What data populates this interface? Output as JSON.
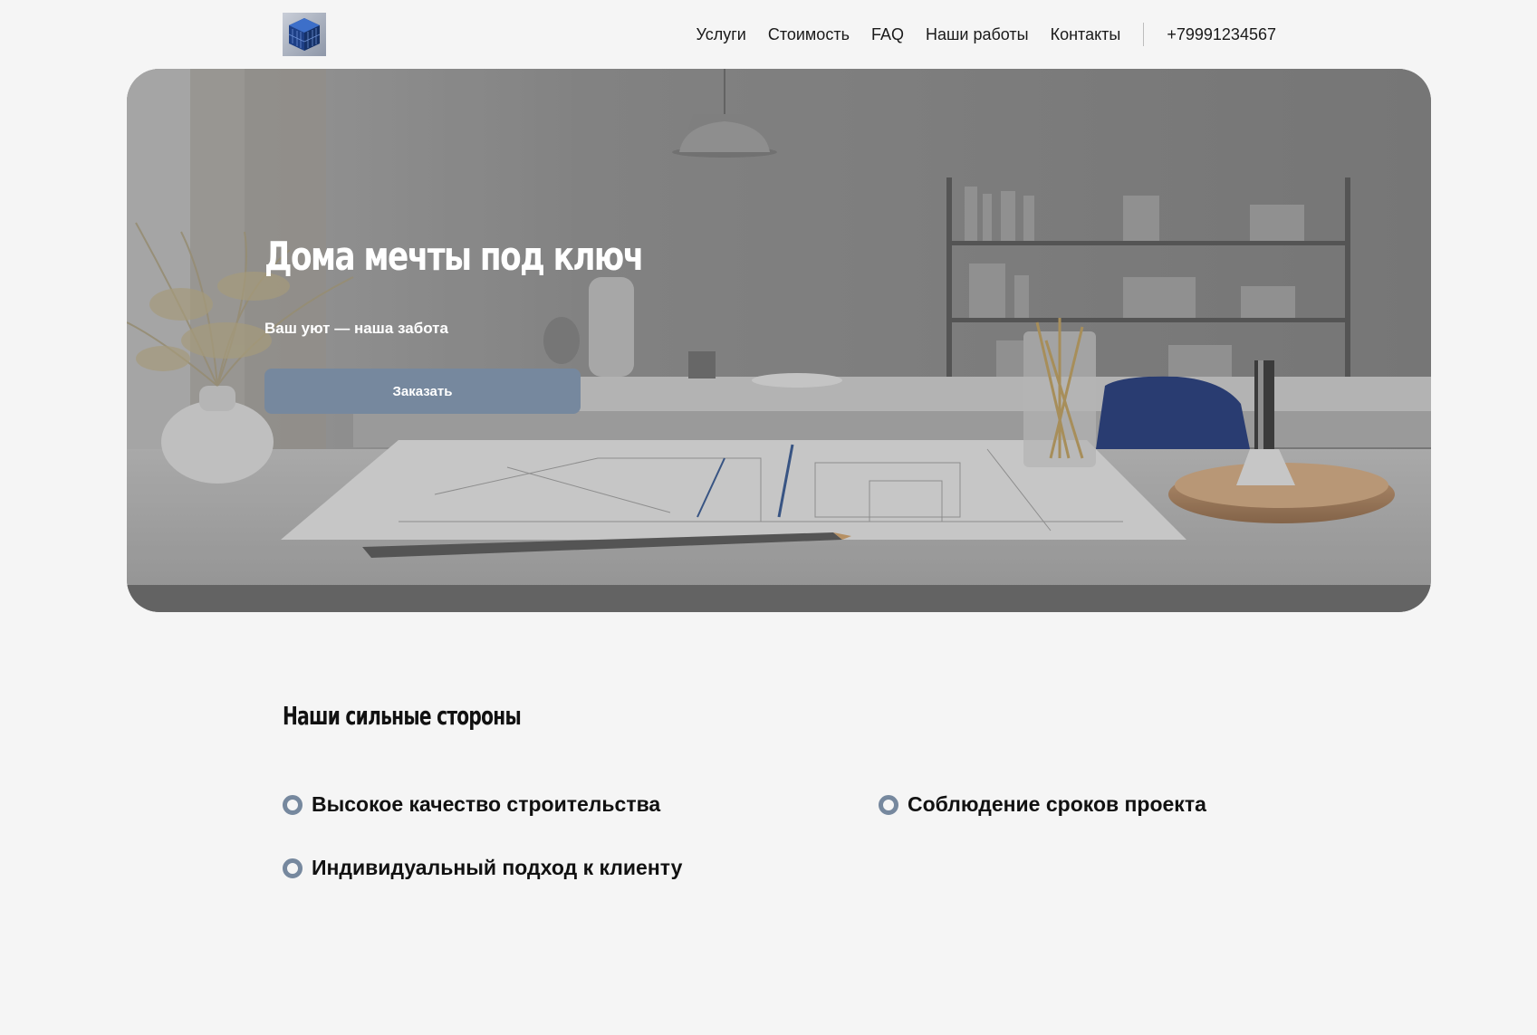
{
  "header": {
    "logo_icon": "house-cube-logo-icon",
    "nav": [
      {
        "label": "Услуги"
      },
      {
        "label": "Стоимость"
      },
      {
        "label": "FAQ"
      },
      {
        "label": "Наши работы"
      },
      {
        "label": "Контакты"
      }
    ],
    "phone": "+79991234567"
  },
  "hero": {
    "title": "Дома мечты под ключ",
    "subtitle": "Ваш уют — наша забота",
    "button_label": "Заказать",
    "button_color": "#76889e"
  },
  "strengths": {
    "title": "Наши сильные стороны",
    "items": [
      {
        "label": "Высокое качество строительства"
      },
      {
        "label": "Соблюдение сроков проекта"
      },
      {
        "label": "Индивидуальный подход к клиенту"
      }
    ],
    "bullet_color": "#76889e"
  },
  "colors": {
    "background": "#f5f5f5",
    "accent": "#76889e"
  }
}
